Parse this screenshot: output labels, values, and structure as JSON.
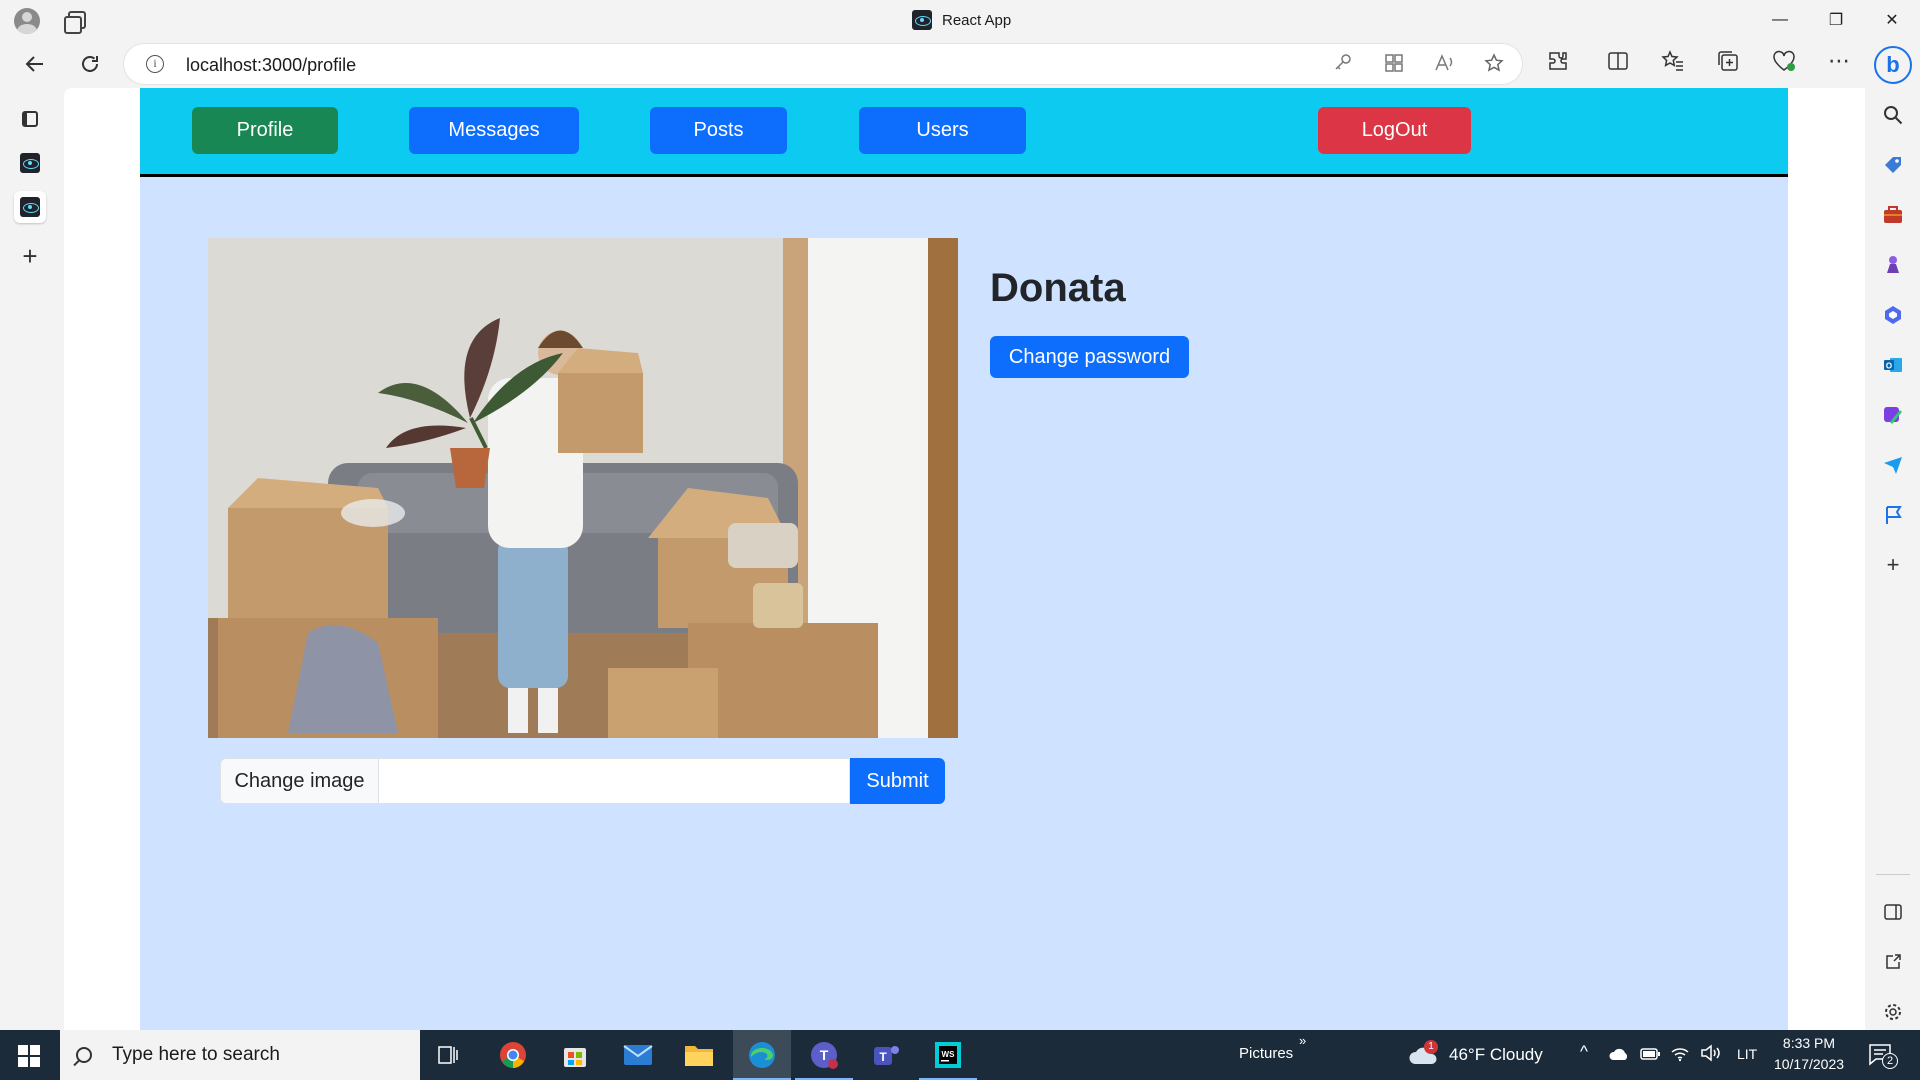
{
  "window": {
    "title": "React App",
    "controls": {
      "minimize": "—",
      "restore": "❐",
      "close": "✕"
    }
  },
  "browser": {
    "url": "localhost:3000/profile",
    "bing_label": "b"
  },
  "app": {
    "nav": {
      "profile": "Profile",
      "messages": "Messages",
      "posts": "Posts",
      "users": "Users",
      "logout": "LogOut"
    },
    "profile": {
      "username": "Donata",
      "change_password": "Change password",
      "change_image": "Change image",
      "submit": "Submit"
    }
  },
  "taskbar": {
    "search_placeholder": "Type here to search",
    "pictures_label": "Pictures",
    "weather": "46°F  Cloudy",
    "weather_badge": "1",
    "language": "LIT",
    "time": "8:33 PM",
    "date": "10/17/2023",
    "notification_count": "2"
  },
  "colors": {
    "app_nav": "#0dcaf0",
    "app_bg": "#cfe2ff",
    "primary": "#0d6efd",
    "success": "#198754",
    "danger": "#dc3545"
  }
}
